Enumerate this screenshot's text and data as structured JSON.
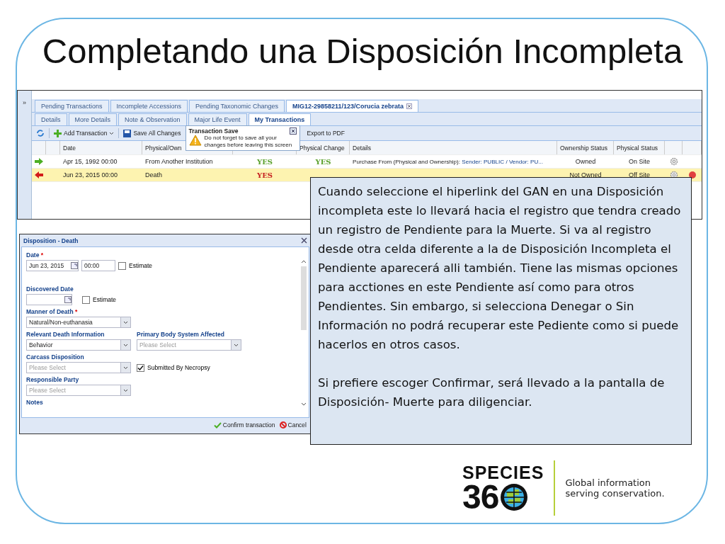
{
  "title": "Completando una Disposición Incompleta",
  "grid_window": {
    "expander": "»",
    "tabs": [
      {
        "label": "Pending Transactions",
        "selected": false
      },
      {
        "label": "Incomplete Accessions",
        "selected": false
      },
      {
        "label": "Pending Taxonomic Changes",
        "selected": false
      },
      {
        "label": "MIG12-29858211/123/Corucia zebrata",
        "selected": true,
        "closable": true
      }
    ],
    "subtabs": [
      {
        "label": "Details",
        "selected": false
      },
      {
        "label": "More Details",
        "selected": false
      },
      {
        "label": "Note & Observation",
        "selected": false
      },
      {
        "label": "Major Life Event",
        "selected": false
      },
      {
        "label": "My Transactions",
        "selected": true
      }
    ],
    "toolbar": {
      "add": "Add Transaction",
      "save": "Save All Changes",
      "export": "Export to PDF"
    },
    "tooltip": {
      "title": "Transaction Save",
      "message": "Do not forget to save all your changes before leaving this screen"
    },
    "columns": [
      "Date",
      "Physical/Own",
      "Physical Change",
      "Details",
      "Ownership Status",
      "Physical Status"
    ],
    "rows": [
      {
        "kind": "incoming",
        "selected": false,
        "date": "Apr 15, 1992 00:00",
        "type": "From Another Institution",
        "ownership_change": "YES",
        "physical_change": "YES",
        "details": "Purchase From (Physical and Ownership):",
        "details_link": "Sender: PUBLIC / Vendor: PU...",
        "ownership_status": "Owned",
        "physical_status": "On Site"
      },
      {
        "kind": "outgoing",
        "selected": true,
        "date": "Jun 23, 2015 00:00",
        "type": "Death",
        "ownership_change": "YES",
        "ownership_status": "Not Owned",
        "physical_status": "Off Site"
      }
    ]
  },
  "dialog": {
    "title": "Disposition - Death",
    "date": {
      "label": "Date",
      "required_mark": "*",
      "value": "Jun 23, 2015",
      "time": "00:00",
      "estimate": {
        "label": "Estimate",
        "checked": false
      }
    },
    "discovered": {
      "label": "Discovered Date",
      "estimate": {
        "label": "Estimate",
        "checked": false
      }
    },
    "manner": {
      "label": "Manner of Death",
      "required_mark": "*",
      "value": "Natural/Non-euthanasia"
    },
    "relevant": {
      "label": "Relevant Death Information",
      "value": "Behavior"
    },
    "primary": {
      "label": "Primary Body System Affected",
      "placeholder": "Please Select"
    },
    "carcass": {
      "label": "Carcass Disposition",
      "placeholder": "Please Select"
    },
    "necropsy": {
      "label": "Submitted By Necropsy",
      "checked": true
    },
    "responsible": {
      "label": "Responsible Party",
      "placeholder": "Please Select"
    },
    "notes": {
      "label": "Notes"
    },
    "confirm": "Confirm transaction",
    "cancel": "Cancel"
  },
  "callout": [
    "Cuando seleccione el hiperlink del GAN en una Disposición incompleta este lo llevará hacia el registro que tendra creado un registro de Pendiente para la Muerte. Si va al registro desde otra celda diferente a la de Disposición Incompleta el Pendiente aparecerá alli también. Tiene las mismas opciones para acctiones en este Pendiente así como para otros Pendientes. Sin embargo, si selecciona Denegar o Sin Información no podrá recuperar este Pediente como si puede hacerlos en otros casos.",
    "Si prefiere escoger Confirmar, será llevado a la pantalla de Disposición- Muerte para diligenciar."
  ],
  "logo": {
    "wordmark": "SPECIES",
    "number": "36",
    "tagline": [
      "Global information",
      "serving conservation."
    ]
  }
}
